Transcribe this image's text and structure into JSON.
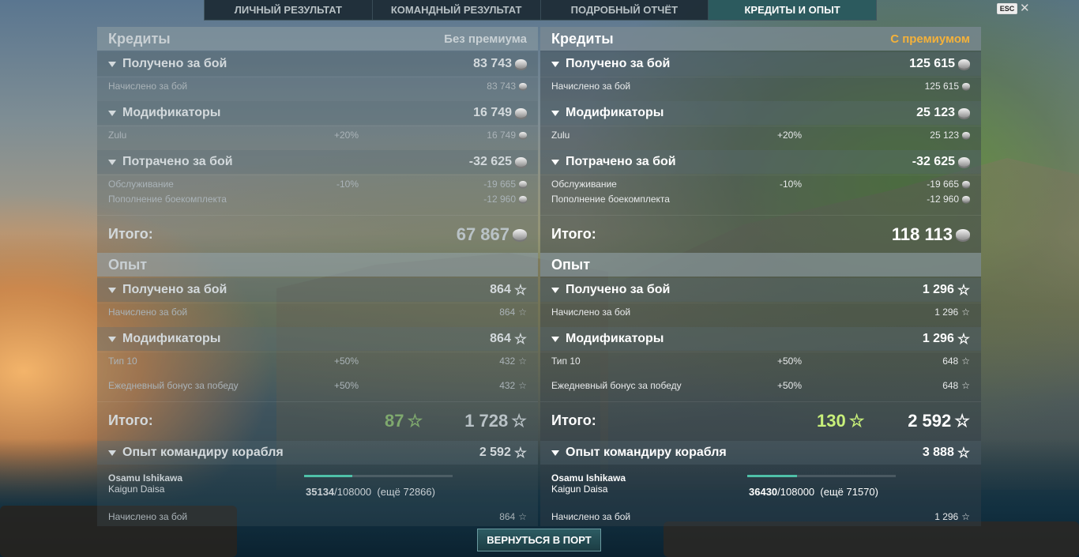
{
  "tabs": [
    {
      "label": "ЛИЧНЫЙ РЕЗУЛЬТАТ"
    },
    {
      "label": "КОМАНДНЫЙ РЕЗУЛЬТАТ"
    },
    {
      "label": "ПОДРОБНЫЙ ОТЧЁТ"
    },
    {
      "label": "КРЕДИТЫ И ОПЫТ"
    }
  ],
  "esc_label": "ESC",
  "left": {
    "credits_title": "Кредиты",
    "premium_label": "Без премиума",
    "earned_label": "Получено за бой",
    "earned_value": "83 743",
    "accrued_label": "Начислено за бой",
    "accrued_value": "83 743",
    "mods_label": "Модификаторы",
    "mods_value": "16 749",
    "zulu_label": "Zulu",
    "zulu_pct": "+20%",
    "zulu_value": "16 749",
    "spent_label": "Потрачено за бой",
    "spent_value": "-32 625",
    "service_label": "Обслуживание",
    "service_pct": "-10%",
    "service_value": "-19 665",
    "ammo_label": "Пополнение боекомплекта",
    "ammo_value": "-12 960",
    "total_label": "Итого:",
    "total_value": "67 867",
    "xp_title": "Опыт",
    "xp_earned_label": "Получено за бой",
    "xp_earned_value": "864",
    "xp_accrued_label": "Начислено за бой",
    "xp_accrued_value": "864",
    "xp_mods_label": "Модификаторы",
    "xp_mods_value": "864",
    "tier_label": "Тип 10",
    "tier_pct": "+50%",
    "tier_value": "432",
    "daily_label": "Ежедневный бонус за победу",
    "daily_pct": "+50%",
    "daily_value": "432",
    "xp_total_label": "Итого:",
    "free_xp": "87",
    "xp_total_value": "1 728",
    "cmdr_label": "Опыт командиру корабля",
    "cmdr_value": "2 592",
    "cmdr_name": "Osamu Ishikawa",
    "cmdr_rank": "Kaigun Daisa",
    "cmdr_xp": "35134",
    "cmdr_xp_max": "/108000",
    "cmdr_xp_left": "(ещё 72866)",
    "cmdr_progress": 0.325,
    "cmdr_accrued_label": "Начислено за бой",
    "cmdr_accrued_value": "864"
  },
  "right": {
    "credits_title": "Кредиты",
    "premium_label": "С премиумом",
    "earned_label": "Получено за бой",
    "earned_value": "125 615",
    "accrued_label": "Начислено за бой",
    "accrued_value": "125 615",
    "mods_label": "Модификаторы",
    "mods_value": "25 123",
    "zulu_label": "Zulu",
    "zulu_pct": "+20%",
    "zulu_value": "25 123",
    "spent_label": "Потрачено за бой",
    "spent_value": "-32 625",
    "service_label": "Обслуживание",
    "service_pct": "-10%",
    "service_value": "-19 665",
    "ammo_label": "Пополнение боекомплекта",
    "ammo_value": "-12 960",
    "total_label": "Итого:",
    "total_value": "118 113",
    "xp_title": "Опыт",
    "xp_earned_label": "Получено за бой",
    "xp_earned_value": "1 296",
    "xp_accrued_label": "Начислено за бой",
    "xp_accrued_value": "1 296",
    "xp_mods_label": "Модификаторы",
    "xp_mods_value": "1 296",
    "tier_label": "Тип 10",
    "tier_pct": "+50%",
    "tier_value": "648",
    "daily_label": "Ежедневный бонус за победу",
    "daily_pct": "+50%",
    "daily_value": "648",
    "xp_total_label": "Итого:",
    "free_xp": "130",
    "xp_total_value": "2 592",
    "cmdr_label": "Опыт командиру корабля",
    "cmdr_value": "3 888",
    "cmdr_name": "Osamu Ishikawa",
    "cmdr_rank": "Kaigun Daisa",
    "cmdr_xp": "36430",
    "cmdr_xp_max": "/108000",
    "cmdr_xp_left": "(ещё 71570)",
    "cmdr_progress": 0.337,
    "cmdr_accrued_label": "Начислено за бой",
    "cmdr_accrued_value": "1 296"
  },
  "colors": {
    "free_xp_left": "#7fa96e",
    "free_xp_right": "#c8f07a",
    "premium_accent": "#f3b13b"
  },
  "icons": {
    "credits": "credits-coin-icon",
    "xp": "star-icon"
  },
  "back_button": "ВЕРНУТЬСЯ В ПОРТ"
}
